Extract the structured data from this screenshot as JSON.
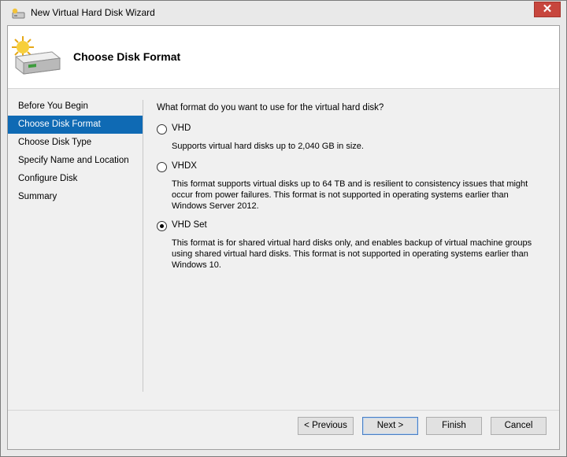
{
  "window": {
    "title": "New Virtual Hard Disk Wizard",
    "close_label": "✕"
  },
  "header": {
    "title": "Choose Disk Format"
  },
  "sidebar": {
    "items": [
      {
        "label": "Before You Begin"
      },
      {
        "label": "Choose Disk Format",
        "selected": true
      },
      {
        "label": "Choose Disk Type"
      },
      {
        "label": "Specify Name and Location"
      },
      {
        "label": "Configure Disk"
      },
      {
        "label": "Summary"
      }
    ]
  },
  "main": {
    "question": "What format do you want to use for the virtual hard disk?",
    "options": [
      {
        "label": "VHD",
        "checked": false,
        "description": "Supports virtual hard disks up to 2,040 GB in size."
      },
      {
        "label": "VHDX",
        "checked": false,
        "description": "This format supports virtual disks up to 64 TB and is resilient to consistency issues that might occur from power failures. This format is not supported in operating systems earlier than Windows Server 2012."
      },
      {
        "label": "VHD Set",
        "checked": true,
        "description": "This format is for shared virtual hard disks only, and enables backup of virtual machine groups using shared virtual hard disks. This format is not supported in operating systems earlier than Windows 10."
      }
    ]
  },
  "footer": {
    "previous_label": "< Previous",
    "next_label": "Next >",
    "finish_label": "Finish",
    "cancel_label": "Cancel"
  },
  "colors": {
    "selected_nav": "#0f6ab4",
    "close_button": "#c7463d"
  }
}
